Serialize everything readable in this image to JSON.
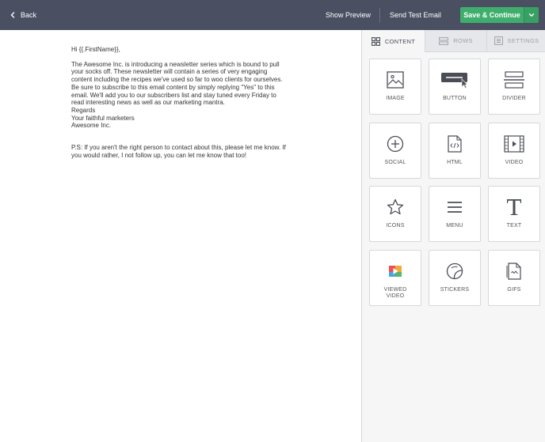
{
  "topbar": {
    "back_label": "Back",
    "show_preview_label": "Show Preview",
    "send_test_label": "Send Test Email",
    "save_label": "Save & Continue"
  },
  "email": {
    "greeting": "Hi {{.FirstName}},",
    "body_lines": [
      "The Awesome Inc. is introducing a newsletter series which is bound to pull",
      "your socks off. These newsletter will contain a series of very engaging",
      "content including the recipes we've used so far to woo clients for ourselves.",
      "Be sure to subscribe to this email content by simply replying \"Yes\" to this",
      "email. We'll add you to our subscribers list and stay tuned every Friday to",
      "read interesting news as well as our marketing mantra.",
      "Regards",
      "Your faithful marketers",
      "Awesome Inc."
    ],
    "ps_lines": [
      "P.S: If you aren't the right person to contact about this, please let me know. If",
      "you would rather, I not follow up, you can let me know that too!"
    ]
  },
  "panel": {
    "tabs": [
      {
        "label": "CONTENT",
        "icon": "grid-icon",
        "active": true
      },
      {
        "label": "ROWS",
        "icon": "rows-icon",
        "active": false
      },
      {
        "label": "SETTINGS",
        "icon": "settings-icon",
        "active": false
      }
    ],
    "tiles": [
      {
        "label": "IMAGE",
        "icon": "image-icon"
      },
      {
        "label": "BUTTON",
        "icon": "button-icon"
      },
      {
        "label": "DIVIDER",
        "icon": "divider-icon"
      },
      {
        "label": "SOCIAL",
        "icon": "social-icon"
      },
      {
        "label": "HTML",
        "icon": "html-icon"
      },
      {
        "label": "VIDEO",
        "icon": "video-icon"
      },
      {
        "label": "ICONS",
        "icon": "star-icon"
      },
      {
        "label": "MENU",
        "icon": "menu-icon"
      },
      {
        "label": "TEXT",
        "icon": "text-icon"
      },
      {
        "label": "VIEWED VIDEO",
        "icon": "viewed-video-icon"
      },
      {
        "label": "STICKERS",
        "icon": "sticker-icon"
      },
      {
        "label": "GIFS",
        "icon": "gif-icon"
      }
    ]
  },
  "colors": {
    "topbar": "#4a5062",
    "save_green": "#3fae6d",
    "panel_bg": "#f6f6f7"
  }
}
